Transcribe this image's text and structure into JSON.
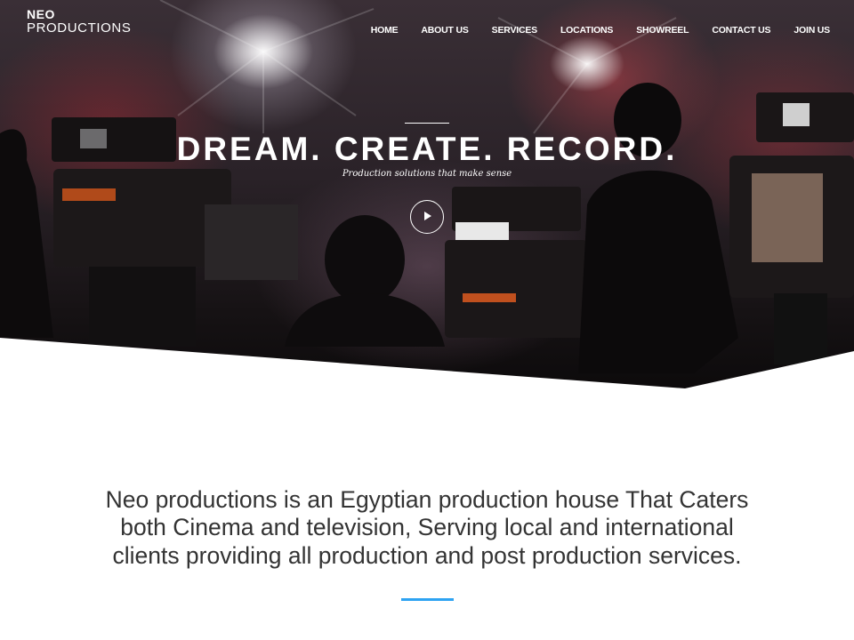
{
  "brand": {
    "logo_top": "NEO",
    "logo_bottom": "PRODUCTIONS"
  },
  "nav": {
    "items": [
      {
        "label": "HOME"
      },
      {
        "label": "ABOUT US"
      },
      {
        "label": "SERVICES"
      },
      {
        "label": "LOCATIONS"
      },
      {
        "label": "SHOWREEL"
      },
      {
        "label": "CONTACT US"
      },
      {
        "label": "JOIN US"
      }
    ]
  },
  "hero": {
    "title": "DREAM. CREATE. RECORD.",
    "subtitle": "Production solutions that make sense",
    "play_icon": "play-icon"
  },
  "intro": {
    "text": "Neo productions is an Egyptian production house That Caters both Cinema and television, Serving local and international clients providing all production and post production services."
  },
  "colors": {
    "accent": "#2ea3f2",
    "text_dark": "#333333",
    "hero_text": "#ffffff"
  }
}
